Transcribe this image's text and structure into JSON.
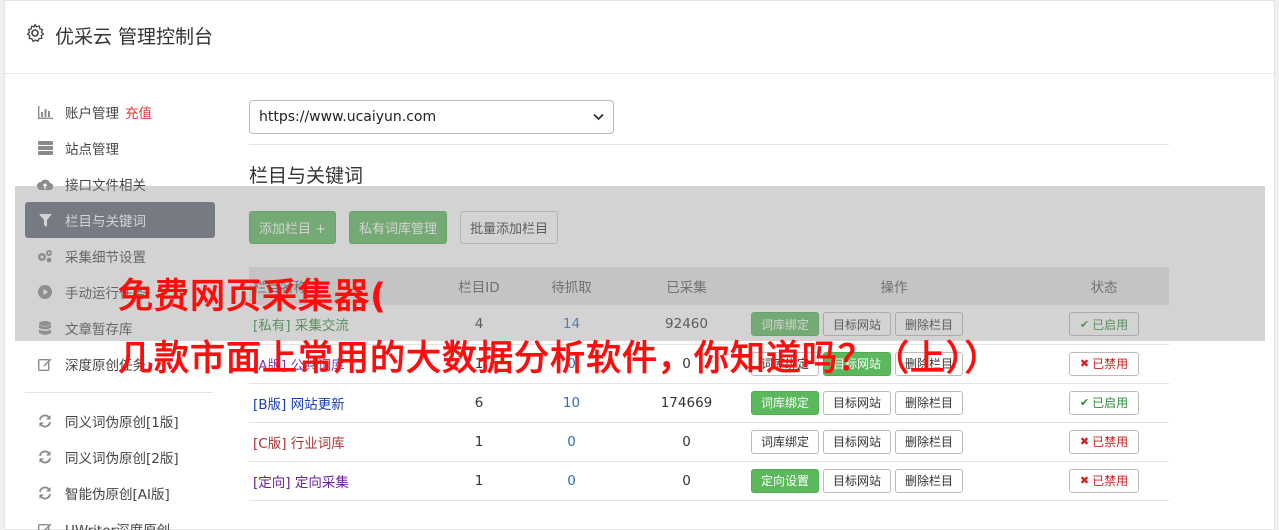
{
  "header": {
    "title": "优采云 管理控制台",
    "icon": "gear-icon"
  },
  "sidebar": {
    "items": [
      {
        "label": "账户管理",
        "extra": "充值",
        "icon": "bar-chart-icon"
      },
      {
        "label": "站点管理",
        "icon": "server-icon"
      },
      {
        "label": "接口文件相关",
        "icon": "cloud-upload-icon"
      },
      {
        "label": "栏目与关键词",
        "icon": "filter-icon",
        "active": true
      },
      {
        "label": "采集细节设置",
        "icon": "cogs-icon"
      },
      {
        "label": "手动运行任务",
        "icon": "play-circle-icon"
      },
      {
        "label": "文章暂存库",
        "icon": "database-icon"
      },
      {
        "label": "深度原创任务",
        "icon": "edit-icon"
      },
      {
        "label": "同义词伪原创[1版]",
        "icon": "refresh-icon"
      },
      {
        "label": "同义词伪原创[2版]",
        "icon": "refresh-icon"
      },
      {
        "label": "智能伪原创[AI版]",
        "icon": "refresh-icon"
      },
      {
        "label": "UWriter深度原创",
        "icon": "edit-icon"
      }
    ]
  },
  "main": {
    "site_select": {
      "value": "https://www.ucaiyun.com"
    },
    "section_title": "栏目与关键词",
    "buttons": {
      "add": "添加栏目 +",
      "private_lib": "私有词库管理",
      "batch_add": "批量添加栏目"
    },
    "table": {
      "headers": [
        "栏目名称",
        "栏目ID",
        "待抓取",
        "已采集",
        "操作",
        "状态"
      ],
      "rows": [
        {
          "tag": "[私有]",
          "name": "采集交流",
          "id": "4",
          "pending": "14",
          "collected": "92460",
          "op1": "词库绑定",
          "op2": "目标网站",
          "op3": "删除栏目",
          "status": "已启用"
        },
        {
          "tag": "[A版]",
          "name": "公共词库",
          "id": "1",
          "pending": "0",
          "collected": "0",
          "op1": "词库绑定",
          "op2": "目标网站",
          "op3": "删除栏目",
          "status": "已禁用"
        },
        {
          "tag": "[B版]",
          "name": "网站更新",
          "id": "6",
          "pending": "10",
          "collected": "174669",
          "op1": "词库绑定",
          "op2": "目标网站",
          "op3": "删除栏目",
          "status": "已启用"
        },
        {
          "tag": "[C版]",
          "name": "行业词库",
          "id": "1",
          "pending": "0",
          "collected": "0",
          "op1": "词库绑定",
          "op2": "目标网站",
          "op3": "删除栏目",
          "status": "已禁用"
        },
        {
          "tag": "[定向]",
          "name": "定向采集",
          "id": "1",
          "pending": "0",
          "collected": "0",
          "op1": "定向设置",
          "op2": "目标网站",
          "op3": "删除栏目",
          "status": "已禁用"
        }
      ]
    }
  },
  "overlay": {
    "line1": "免费网页采集器(",
    "line2": "几款市面上常用的大数据分析软件，你知道吗？（上））"
  },
  "colors": {
    "accent_green": "#5cb85c",
    "active_nav": "#5d6675",
    "overlay_text": "#ff0d0d"
  }
}
